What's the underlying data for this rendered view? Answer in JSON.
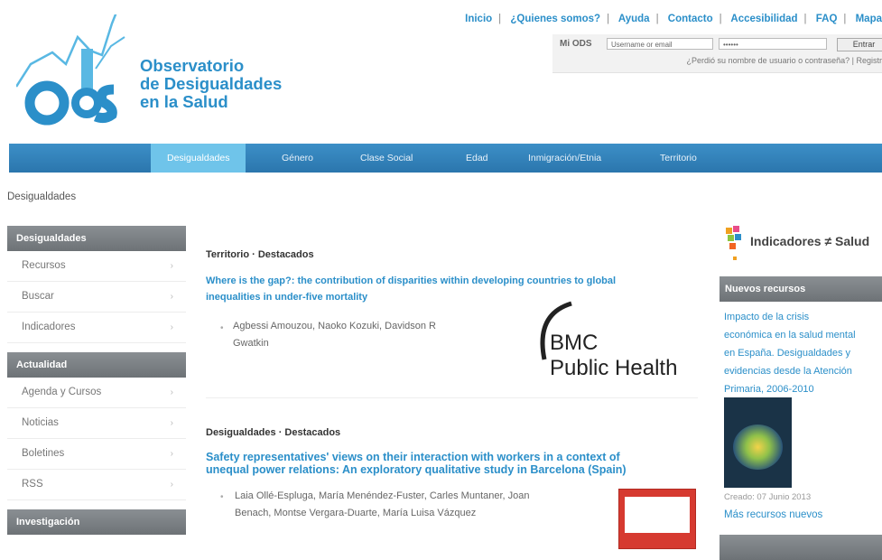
{
  "header": {
    "logo_acronym": "ods",
    "logo_lines": [
      "Observatorio",
      "de Desigualdades",
      "en la Salud"
    ],
    "top_links": [
      "Inicio",
      "¿Quienes somos?",
      "Ayuda",
      "Contacto",
      "Accesibilidad",
      "FAQ",
      "Mapa"
    ],
    "login": {
      "label": "Mi ODS",
      "username_placeholder": "Username or email",
      "password_value": "••••••",
      "submit": "Entrar",
      "forgot": "¿Perdió su nombre de usuario o contraseña? | Registr"
    }
  },
  "nav": {
    "tabs": [
      "Desigualdades",
      "Género",
      "Clase Social",
      "Edad",
      "Inmigración/Etnia",
      "Territorio"
    ],
    "active": "Desigualdades"
  },
  "breadcrumb": "Desigualdades",
  "sidebar": {
    "sections": [
      {
        "title": "Desigualdades",
        "items": [
          "Recursos",
          "Buscar",
          "Indicadores"
        ]
      },
      {
        "title": "Actualidad",
        "items": [
          "Agenda y Cursos",
          "Noticias",
          "Boletines",
          "RSS"
        ]
      },
      {
        "title": "Investigación",
        "items": []
      }
    ]
  },
  "main": {
    "articles": [
      {
        "section": "Territorio · Destacados",
        "title_lines": [
          "Where is the gap?: the contribution of disparities within developing countries to global",
          "inequalities in under-five mortality"
        ],
        "authors_lines": [
          "Agbessi Amouzou, Naoko Kozuki, Davidson R",
          "Gwatkin"
        ],
        "image_lines": [
          "BMC",
          "Public Health"
        ]
      },
      {
        "section": "Desigualdades · Destacados",
        "title_lines": [
          "Safety representatives' views on their interaction with workers in a context of",
          "unequal power relations: An exploratory qualitative study in Barcelona (Spain)"
        ],
        "authors_lines": [
          "Laia Ollé-Espluga, María Menéndez-Fuster, Carles Muntaner, Joan",
          "Benach, Montse Vergara-Duarte, María Luisa Vázquez"
        ]
      }
    ]
  },
  "right": {
    "indicadores_title": "Indicadores ≠ Salud",
    "new_resources_title": "Nuevos recursos",
    "resource_lines": [
      "Impacto de la crisis",
      "económica en la salud mental",
      "en España. Desigualdades y",
      "evidencias desde la Atención",
      "Primaria, 2006-2010"
    ],
    "created": "Creado: 07 Junio 2013",
    "more": "Más recursos nuevos"
  },
  "colors": {
    "brand_blue": "#2b8fc9",
    "nav_blue": "#2b76ad",
    "nav_active": "#6fc4ea",
    "sidebar_head": "#6d7276"
  }
}
